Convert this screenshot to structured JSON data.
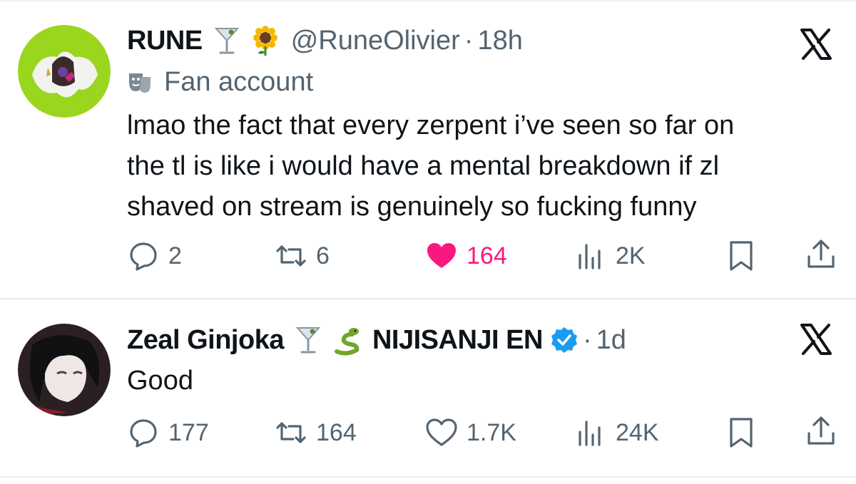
{
  "tweets": [
    {
      "author_name": "RUNE",
      "name_emojis": [
        "cocktail-glass-emoji",
        "sunflower-emoji"
      ],
      "handle": "@RuneOlivier",
      "separator": "·",
      "time": "18h",
      "label": "Fan account",
      "label_icon": "theater-mask-icon",
      "text_lines": [
        "lmao the fact that every zerpent i’ve seen so far on",
        "the tl is like i would have a mental breakdown if zl",
        "shaved on stream is genuinely so fucking funny"
      ],
      "replies": "2",
      "retweets": "6",
      "likes": "164",
      "liked": true,
      "views": "2K",
      "accent_like": "#f91880"
    },
    {
      "author_name": "Zeal Ginjoka",
      "name_emojis": [
        "cocktail-glass-emoji",
        "snake-emoji"
      ],
      "affiliation": "NIJISANJI EN",
      "verified": true,
      "separator": "·",
      "time": "1d",
      "text_lines": [
        "Good"
      ],
      "replies": "177",
      "retweets": "164",
      "likes": "1.7K",
      "liked": false,
      "views": "24K",
      "verified_color": "#1d9bf0"
    }
  ]
}
